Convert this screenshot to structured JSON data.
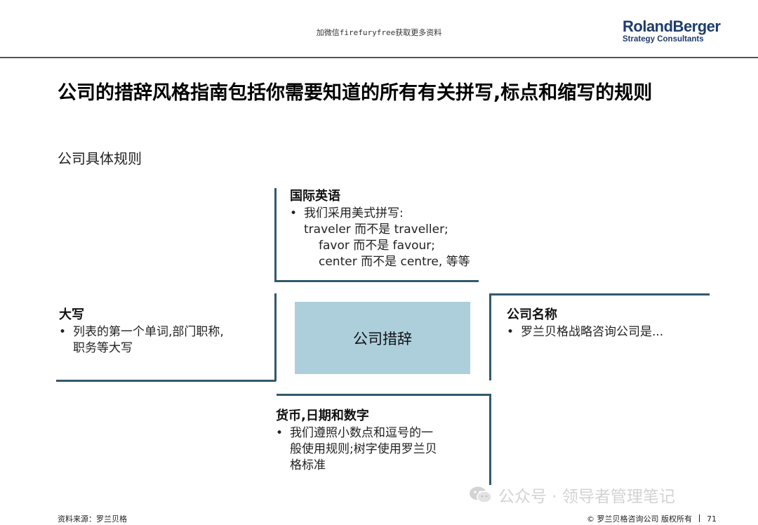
{
  "header": {
    "note": "加微信firefuryfree获取更多资料",
    "logo_main": "RolandBerger",
    "logo_sub": "Strategy Consultants"
  },
  "title": "公司的措辞风格指南包括你需要知道的所有有关拼写,标点和缩写的规则",
  "subtitle": "公司具体规则",
  "center": {
    "label": "公司措辞"
  },
  "top_block": {
    "heading": "国际英语",
    "bullet": "我们采用美式拼写:",
    "lines": [
      "traveler 而不是 traveller;",
      "favor 而不是 favour;",
      "center 而不是 centre, 等等"
    ]
  },
  "left_block": {
    "heading": "大写",
    "bullet_line1": "列表的第一个单词,部门职称,",
    "bullet_line2": "职务等大写"
  },
  "right_block": {
    "heading": "公司名称",
    "bullet": "罗兰贝格战略咨询公司是..."
  },
  "bottom_block": {
    "heading": "货币,日期和数字",
    "bullet_line1": "我们遵照小数点和逗号的一",
    "bullet_line2": "般使用规则;树字使用罗兰贝",
    "bullet_line3": "格标准"
  },
  "watermark": {
    "text": "公众号 · 领导者管理笔记",
    "icon": "wechat-icon"
  },
  "footer": {
    "source": "资料来源：罗兰贝格",
    "copyright": "© 罗兰贝格咨询公司 版权所有",
    "page": "71"
  },
  "colors": {
    "rule": "#31596b",
    "center_fill": "#adcfdc",
    "logo": "#1f3d6b"
  }
}
